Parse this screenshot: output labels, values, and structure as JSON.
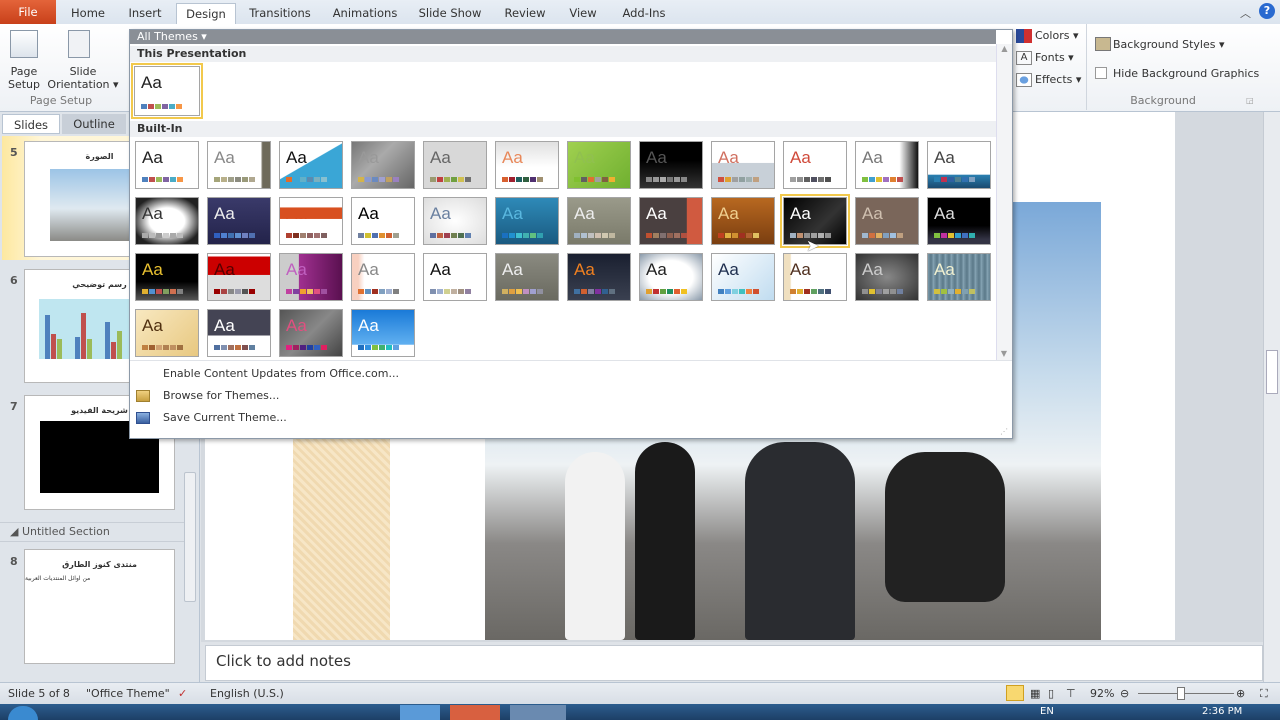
{
  "ribbon_tabs": [
    "File",
    "Home",
    "Insert",
    "Design",
    "Transitions",
    "Animations",
    "Slide Show",
    "Review",
    "View",
    "Add-Ins"
  ],
  "active_tab": "Design",
  "page_setup": {
    "page_setup_label": "Page Setup",
    "slide_orientation_label": "Slide Orientation",
    "group_label": "Page Setup"
  },
  "themes_group": {
    "colors": "Colors",
    "fonts": "Fonts",
    "effects": "Effects"
  },
  "background_group": {
    "background_styles": "Background Styles",
    "hide_background_graphics": "Hide Background Graphics",
    "hide_checked": false,
    "group_label": "Background"
  },
  "gallery": {
    "filter_label": "All Themes",
    "this_presentation_label": "This Presentation",
    "builtin_label": "Built-In",
    "current_theme": {
      "aa": "Aa",
      "bg": "#ffffff",
      "fg": "#222222",
      "swatches": [
        "#4f81bd",
        "#c0504d",
        "#9bbb59",
        "#8064a2",
        "#4bacc6",
        "#f79646"
      ]
    },
    "themes": [
      {
        "aa": "Aa",
        "bg": "#ffffff",
        "fg": "#222",
        "swatches": [
          "#4f81bd",
          "#c0504d",
          "#9bbb59",
          "#8064a2",
          "#4bacc6",
          "#f79646"
        ]
      },
      {
        "aa": "Aa",
        "bg": "linear-gradient(90deg,#fff 85%,#6e6a5a 88%)",
        "fg": "#888",
        "swatches": [
          "#a5a57a",
          "#b8b08a",
          "#a0a08a",
          "#8c8c80",
          "#9a9a7a",
          "#b0a890"
        ]
      },
      {
        "aa": "Aa",
        "bg": "linear-gradient(150deg,#fff 45%,#3aa6d6 46%)",
        "fg": "#111",
        "swatches": [
          "#e36c2a",
          "#3aa6d6",
          "#62b0c8",
          "#5a8ab0",
          "#7ab0c0",
          "#88c0d0"
        ]
      },
      {
        "aa": "Aa",
        "bg": "linear-gradient(135deg,#777,#aaa 40%,#666)",
        "fg": "#999",
        "swatches": [
          "#d4b44a",
          "#8a9ad0",
          "#6a8ac0",
          "#a0a0d0",
          "#c0a060",
          "#9a80c0"
        ]
      },
      {
        "aa": "Aa",
        "bg": "#d8d8d8",
        "fg": "#666",
        "swatches": [
          "#9a9a70",
          "#c04040",
          "#a0b050",
          "#70a040",
          "#d0c050",
          "#707070"
        ]
      },
      {
        "aa": "Aa",
        "bg": "linear-gradient(#e0e0e0,#fff 55%)",
        "fg": "#e8885a",
        "swatches": [
          "#d86030",
          "#a02030",
          "#206060",
          "#306040",
          "#503070",
          "#a09070"
        ]
      },
      {
        "aa": "Aa",
        "bg": "linear-gradient(135deg,#a0d050,#70b030)",
        "fg": "#90c050",
        "swatches": [
          "#80c030",
          "#606060",
          "#e07030",
          "#a0a0a0",
          "#806040",
          "#f0b030"
        ]
      },
      {
        "aa": "Aa",
        "bg": "linear-gradient(#000 40%,#333)",
        "fg": "#555",
        "swatches": [
          "#888",
          "#999",
          "#aaa",
          "#777",
          "#999",
          "#888"
        ]
      },
      {
        "aa": "Aa",
        "bg": "linear-gradient(#fff 45%,#c8d0d8 46%)",
        "fg": "#d07060",
        "swatches": [
          "#d05040",
          "#e0a030",
          "#a0a0a0",
          "#90a0a0",
          "#a0b0b0",
          "#c0a080"
        ]
      },
      {
        "aa": "Aa",
        "bg": "#fff",
        "fg": "#d04a3a",
        "swatches": [
          "#a0a0a0",
          "#909090",
          "#606060",
          "#505060",
          "#707070",
          "#505050"
        ]
      },
      {
        "aa": "Aa",
        "bg": "linear-gradient(90deg,#fff 70%,#111)",
        "fg": "#777",
        "swatches": [
          "#80c040",
          "#40a0d0",
          "#e0c030",
          "#a070c0",
          "#e08030",
          "#c05050"
        ]
      },
      {
        "aa": "Aa",
        "bg": "linear-gradient(#fff 70%,#2a7fb0 72%,#1a4a70)",
        "fg": "#444",
        "swatches": [
          "#2a7fb0",
          "#c03050",
          "#3060a0",
          "#508090",
          "#3070b0",
          "#80a0c0"
        ]
      },
      {
        "aa": "Aa",
        "bg": "radial-gradient(#fff 40%,#222 80%)",
        "fg": "#333",
        "swatches": [
          "#aaa",
          "#bbb",
          "#999",
          "#ccc",
          "#aaa",
          "#bbb"
        ]
      },
      {
        "aa": "Aa",
        "bg": "linear-gradient(#3a3a6a,#23234a)",
        "fg": "#eee",
        "swatches": [
          "#3060c0",
          "#5080d0",
          "#4070b0",
          "#6090d0",
          "#7080c0",
          "#5070b0"
        ]
      },
      {
        "aa": "Aa",
        "bg": "linear-gradient(#fff 20%,#d85020 21%,#d85020 45%,#fff 46%)",
        "fg": "#d85020",
        "swatches": [
          "#b04030",
          "#803020",
          "#a08070",
          "#906060",
          "#a07070",
          "#806060"
        ]
      },
      {
        "aa": "Aa",
        "bg": "#fff",
        "fg": "#000",
        "swatches": [
          "#7080a0",
          "#d0c030",
          "#5070b0",
          "#e09030",
          "#d06030",
          "#a0a090"
        ]
      },
      {
        "aa": "Aa",
        "bg": "radial-gradient(#fff,#ddd)",
        "fg": "#6a80a0",
        "swatches": [
          "#6070a0",
          "#c06040",
          "#a04050",
          "#708050",
          "#507050",
          "#6080b0"
        ]
      },
      {
        "aa": "Aa",
        "bg": "linear-gradient(#2e8ab8,#1a5a80)",
        "fg": "#5ab8e0",
        "swatches": [
          "#1a70c0",
          "#2090d0",
          "#40c0d0",
          "#40b0b0",
          "#60c080",
          "#30a0b0"
        ]
      },
      {
        "aa": "Aa",
        "bg": "linear-gradient(#9a9a8a,#7a7a6a)",
        "fg": "#eee",
        "swatches": [
          "#a0b0c0",
          "#b0c0d0",
          "#c0c0c0",
          "#d0c0b0",
          "#d0c8b0",
          "#c0b8a0"
        ]
      },
      {
        "aa": "Aa",
        "bg": "linear-gradient(90deg,#4a4040 75%,#d05a40 76%)",
        "fg": "#fff",
        "swatches": [
          "#c05030",
          "#a08060",
          "#807070",
          "#906050",
          "#a07060",
          "#b05040"
        ]
      },
      {
        "aa": "Aa",
        "bg": "linear-gradient(#b86820,#7a3e10)",
        "fg": "#f0d090",
        "swatches": [
          "#c04020",
          "#e0b040",
          "#d09030",
          "#a03020",
          "#b06030",
          "#e0c060"
        ]
      },
      {
        "aa": "Aa",
        "bg": "linear-gradient(135deg,#000,#333 60%,#000)",
        "fg": "#fff",
        "swatches": [
          "#a0b0c0",
          "#c09070",
          "#909090",
          "#a0a0a0",
          "#b0b0b0",
          "#909090"
        ],
        "selected": true
      },
      {
        "aa": "Aa",
        "bg": "#7a665a",
        "fg": "#d0c0b0",
        "swatches": [
          "#a0b8d0",
          "#d07040",
          "#e0b060",
          "#80a0c0",
          "#a0c0e0",
          "#c0a080"
        ]
      },
      {
        "aa": "Aa",
        "bg": "linear-gradient(#000 60%,#334 90%)",
        "fg": "#ddd",
        "swatches": [
          "#80c040",
          "#c030a0",
          "#e0c030",
          "#30a0d0",
          "#4070c0",
          "#30b0b0"
        ]
      },
      {
        "aa": "Aa",
        "bg": "linear-gradient(#000 60%,#555)",
        "fg": "#e8c030",
        "swatches": [
          "#e0b030",
          "#5090d0",
          "#c05050",
          "#80a060",
          "#d07050",
          "#808080"
        ]
      },
      {
        "aa": "Aa",
        "bg": "linear-gradient(#fff 5%,#c00 6%,#c00 45%,#ddd 46%)",
        "fg": "#500",
        "swatches": [
          "#900",
          "#a44",
          "#888",
          "#99a",
          "#555",
          "#900"
        ]
      },
      {
        "aa": "Aa",
        "bg": "linear-gradient(90deg,#ccc 30%,#a03090 31%,#5a1050)",
        "fg": "#c060c0",
        "swatches": [
          "#c040a0",
          "#8040a0",
          "#f0a030",
          "#f0c060",
          "#e05080",
          "#a050a0"
        ]
      },
      {
        "aa": "Aa",
        "bg": "linear-gradient(90deg,#f8d0c0 10%,#fff 20%)",
        "fg": "#888",
        "swatches": [
          "#e07030",
          "#6090c0",
          "#a03020",
          "#80a0c0",
          "#a0b0d0",
          "#808080"
        ]
      },
      {
        "aa": "Aa",
        "bg": "#fff",
        "fg": "#111",
        "swatches": [
          "#8090b0",
          "#a0b0d0",
          "#d0d090",
          "#c0b0a0",
          "#a09080",
          "#9080a0"
        ]
      },
      {
        "aa": "Aa",
        "bg": "linear-gradient(#8a8a80,#6a6a60)",
        "fg": "#eee",
        "swatches": [
          "#d0b060",
          "#e0a040",
          "#f0c050",
          "#c090c0",
          "#a0a0d0",
          "#9090a0"
        ]
      },
      {
        "aa": "Aa",
        "bg": "linear-gradient(#1a2030,#3a4050)",
        "fg": "#f08020",
        "swatches": [
          "#4070a0",
          "#d06030",
          "#8080a0",
          "#8030a0",
          "#306090",
          "#607080"
        ]
      },
      {
        "aa": "Aa",
        "bg": "radial-gradient(#fff 50%,#8a9aaa)",
        "fg": "#222",
        "swatches": [
          "#e0a030",
          "#c03030",
          "#60a040",
          "#209060",
          "#e06030",
          "#f0c020"
        ]
      },
      {
        "aa": "Aa",
        "bg": "linear-gradient(135deg,#fff,#c0dcf0)",
        "fg": "#203050",
        "swatches": [
          "#4080c0",
          "#60a0e0",
          "#80d0e0",
          "#40c0c0",
          "#f08040",
          "#d05030"
        ]
      },
      {
        "aa": "Aa",
        "bg": "linear-gradient(90deg,#f0e0c0 10%,#fff 12%)",
        "fg": "#503020",
        "swatches": [
          "#d08030",
          "#e0b030",
          "#a03020",
          "#60a060",
          "#507080",
          "#405070"
        ]
      },
      {
        "aa": "Aa",
        "bg": "radial-gradient(#888,#333)",
        "fg": "#ccc",
        "swatches": [
          "#909090",
          "#e0c030",
          "#808090",
          "#a0a0a0",
          "#909090",
          "#7080a0"
        ]
      },
      {
        "aa": "Aa",
        "bg": "repeating-linear-gradient(90deg,#7a98a8,#5a7888 3px,#8aa8b8 6px)",
        "fg": "#f0f0d0",
        "swatches": [
          "#d0c040",
          "#a0c040",
          "#90b0c0",
          "#e0b030",
          "#80a0b0",
          "#c0c060"
        ]
      },
      {
        "aa": "Aa",
        "bg": "linear-gradient(135deg,#f8e8c0,#e8c880)",
        "fg": "#503010",
        "swatches": [
          "#c08040",
          "#a06030",
          "#d0a070",
          "#b08050",
          "#c09060",
          "#a07040"
        ]
      },
      {
        "aa": "Aa",
        "bg": "linear-gradient(#444454 55%,#fff 56%)",
        "fg": "#fff",
        "swatches": [
          "#5070a0",
          "#8090b0",
          "#a07060",
          "#c07040",
          "#805050",
          "#6080a0"
        ]
      },
      {
        "aa": "Aa",
        "bg": "linear-gradient(135deg,#555,#888 50%,#444)",
        "fg": "#e05080",
        "swatches": [
          "#e02080",
          "#a02060",
          "#502080",
          "#2040a0",
          "#3060c0",
          "#e02060"
        ]
      },
      {
        "aa": "Aa",
        "bg": "linear-gradient(#1a7ad8,#60b0f0 75%,#fff 76%)",
        "fg": "#fff",
        "swatches": [
          "#2070c0",
          "#3090e0",
          "#80c040",
          "#40b070",
          "#20c0c0",
          "#60a0e0"
        ]
      }
    ],
    "menu": [
      {
        "label": "Enable Content Updates from Office.com...",
        "icon": "none"
      },
      {
        "label": "Browse for Themes...",
        "icon": "folder-icon"
      },
      {
        "label": "Save Current Theme...",
        "icon": "save-theme-icon"
      }
    ]
  },
  "left_pane": {
    "tabs": [
      "Slides",
      "Outline"
    ],
    "slides": [
      {
        "number": "5",
        "title": "الصورة",
        "kind": "picture",
        "selected": true
      },
      {
        "number": "6",
        "title": "رسم توضيحي",
        "kind": "chart"
      },
      {
        "number": "7",
        "title": "شريحة الفيديو",
        "kind": "video"
      },
      {
        "number": "8",
        "title": "منتدى كنوز الطارق",
        "bullet": "من اوائل المنتديات العربية",
        "kind": "text"
      }
    ],
    "section_label": "Untitled Section"
  },
  "notes_placeholder": "Click to add notes",
  "status": {
    "slide_info": "Slide 5 of 8",
    "theme": "\"Office Theme\"",
    "language": "English (U.S.)",
    "zoom": "92%",
    "zoom_percent": 92
  },
  "taskbar": {
    "time": "2:36 PM",
    "lang": "EN"
  }
}
